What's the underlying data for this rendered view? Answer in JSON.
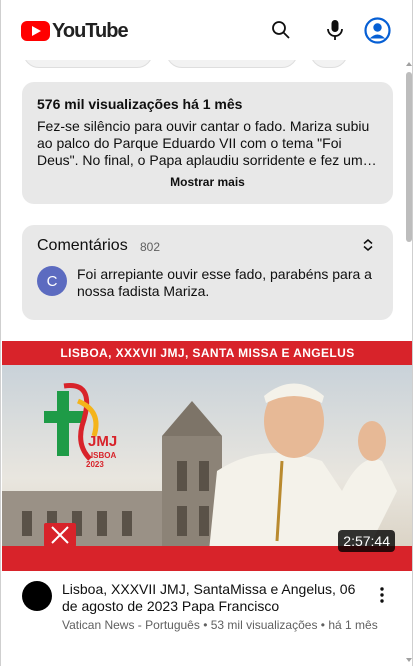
{
  "app": {
    "logo_text": "YouTube"
  },
  "header": {
    "icons": [
      "search-icon",
      "microphone-icon",
      "account-icon"
    ],
    "accent": "#ff0000",
    "account_color": "#065fd4"
  },
  "description": {
    "stats": "576 mil visualizações  há 1 mês",
    "text": "Fez-se silêncio para ouvir cantar o fado. Mariza subiu ao palco do Parque Eduardo VII com o tema \"Foi Deus\". No final, o Papa aplaudiu sorridente e fez um…",
    "show_more": "Mostrar mais"
  },
  "comments": {
    "title": "Comentários",
    "count": "802",
    "avatar_letter": "C",
    "top_comment": "Foi arrepiante ouvir esse fado, parabéns para a nossa fadista Mariza."
  },
  "next_video": {
    "banner_text": "LISBOA, XXXVII JMJ, SANTA MISSA E ANGELUS",
    "logo_text": "JMJ",
    "logo_subtext": "LISBOA 2023",
    "duration": "2:57:44",
    "title": "Lisboa, XXXVII JMJ, SantaMissa e Angelus, 06 de agosto de 2023 Papa Francisco",
    "channel": "Vatican News - Português",
    "views": "53 mil visualizações",
    "age": "há 1 mês",
    "banner_color": "#d8232a"
  }
}
